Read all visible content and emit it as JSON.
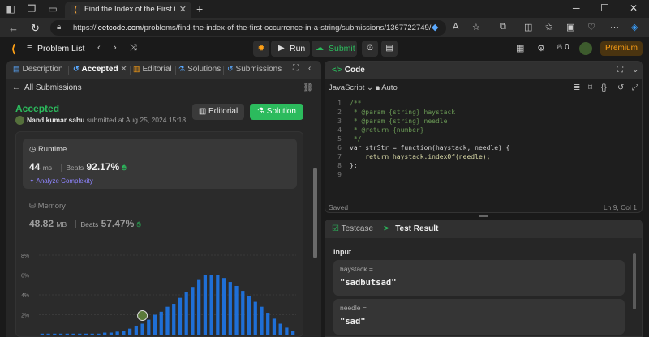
{
  "browser": {
    "tab_title": "Find the Index of the First Occurrence in a String",
    "url_prefix": "https://",
    "url_host": "leetcode.com",
    "url_path": "/problems/find-the-index-of-the-first-occurrence-in-a-string/submissions/1367722749/"
  },
  "header": {
    "problem_list": "Problem List",
    "run_label": "Run",
    "submit_label": "Submit",
    "streak_count": "0",
    "premium_label": "Premium"
  },
  "left_tabs": {
    "description": "Description",
    "accepted": "Accepted",
    "editorial": "Editorial",
    "solutions": "Solutions",
    "submissions": "Submissions"
  },
  "submission": {
    "back_label": "All Submissions",
    "status": "Accepted",
    "user": "Nand kumar sahu",
    "submitted_text": " submitted at Aug 25, 2024 15:18",
    "editorial_button": "Editorial",
    "solution_button": "Solution",
    "runtime": {
      "title": "Runtime",
      "value": "44",
      "unit": "ms",
      "beats_label": "Beats",
      "beats_pct": "92.17%",
      "analyze": "Analyze Complexity"
    },
    "memory": {
      "title": "Memory",
      "value": "48.82",
      "unit": "MB",
      "beats_label": "Beats",
      "beats_pct": "57.47%"
    }
  },
  "chart_data": {
    "type": "bar",
    "ylabel": "",
    "ylim": [
      0,
      8
    ],
    "yticks": [
      "8%",
      "6%",
      "4%",
      "2%"
    ],
    "values": [
      0.1,
      0.1,
      0.1,
      0.1,
      0.1,
      0.1,
      0.1,
      0.1,
      0.1,
      0.1,
      0.2,
      0.2,
      0.3,
      0.4,
      0.6,
      0.9,
      1.1,
      1.5,
      2.0,
      2.3,
      2.8,
      3.1,
      3.7,
      4.3,
      4.8,
      5.5,
      6.0,
      6.0,
      6.0,
      5.7,
      5.3,
      4.9,
      4.4,
      3.9,
      3.3,
      2.8,
      2.2,
      1.6,
      1.1,
      0.7,
      0.4
    ],
    "highlight_index": 16,
    "bar_color": "#1f6fd6"
  },
  "code": {
    "title": "Code",
    "language": "JavaScript",
    "mode": "Auto",
    "lines": [
      "/**",
      " * @param {string} haystack",
      " * @param {string} needle",
      " * @return {number}",
      " */",
      "var strStr = function(haystack, needle) {",
      "    return haystack.indexOf(needle);",
      "};",
      ""
    ],
    "saved": "Saved",
    "cursor": "Ln 9, Col 1"
  },
  "tests": {
    "testcase_tab": "Testcase",
    "result_tab": "Test Result",
    "input_label": "Input",
    "cases": [
      {
        "label": "haystack =",
        "value": "\"sadbutsad\""
      },
      {
        "label": "needle =",
        "value": "\"sad\""
      }
    ]
  }
}
